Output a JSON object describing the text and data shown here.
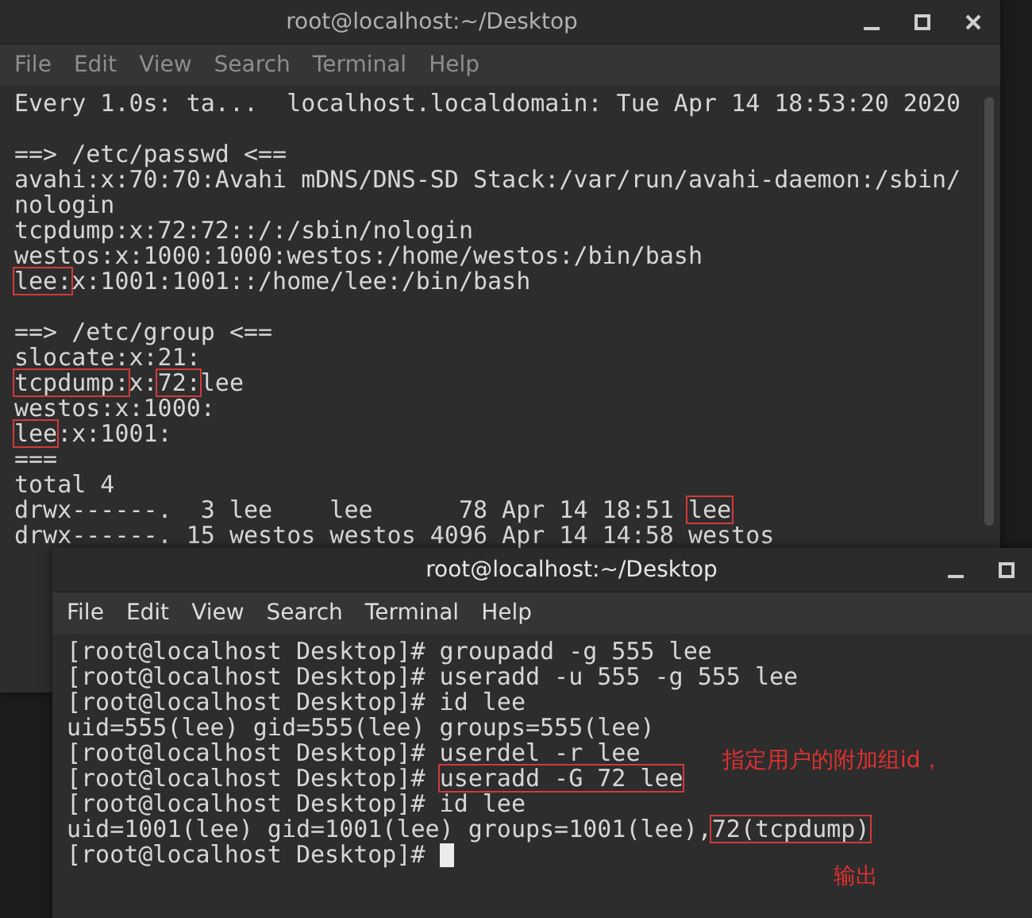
{
  "windows": [
    {
      "title": "root@localhost:~/Desktop",
      "active": false,
      "menu": [
        "File",
        "Edit",
        "View",
        "Search",
        "Terminal",
        "Help"
      ],
      "cursor": false,
      "lines": [
        {
          "segments": [
            {
              "text": "Every 1.0s: ta...  localhost.localdomain: Tue Apr 14 18:53:20 2020",
              "boxed": false
            }
          ]
        },
        {
          "blank_before": true,
          "segments": [
            {
              "text": "==> /etc/passwd <==",
              "boxed": false
            }
          ]
        },
        {
          "segments": [
            {
              "text": "avahi:x:70:70:Avahi mDNS/DNS-SD Stack:/var/run/avahi-daemon:/sbin/",
              "boxed": false
            }
          ]
        },
        {
          "segments": [
            {
              "text": "nologin",
              "boxed": false
            }
          ]
        },
        {
          "segments": [
            {
              "text": "tcpdump:x:72:72::/:/sbin/nologin",
              "boxed": false
            }
          ]
        },
        {
          "segments": [
            {
              "text": "westos:x:1000:1000:westos:/home/westos:/bin/bash",
              "boxed": false
            }
          ]
        },
        {
          "segments": [
            {
              "text": "lee:",
              "boxed": true
            },
            {
              "text": "x:1001:1001::/home/lee:/bin/bash",
              "boxed": false
            }
          ]
        },
        {
          "blank_before": true,
          "segments": [
            {
              "text": "==> /etc/group <==",
              "boxed": false
            }
          ]
        },
        {
          "segments": [
            {
              "text": "slocate:x:21:",
              "boxed": false
            }
          ]
        },
        {
          "segments": [
            {
              "text": "tcpdump:",
              "boxed": true
            },
            {
              "text": "x:",
              "boxed": false
            },
            {
              "text": "72:",
              "boxed": true
            },
            {
              "text": "lee",
              "boxed": false
            }
          ]
        },
        {
          "segments": [
            {
              "text": "westos:x:1000:",
              "boxed": false
            }
          ]
        },
        {
          "segments": [
            {
              "text": "lee",
              "boxed": true
            },
            {
              "text": ":x:1001:",
              "boxed": false
            }
          ]
        },
        {
          "segments": [
            {
              "text": "===",
              "boxed": false
            }
          ]
        },
        {
          "segments": [
            {
              "text": "total 4",
              "boxed": false
            }
          ]
        },
        {
          "segments": [
            {
              "text": "drwx------.  3 lee    lee      78 Apr 14 18:51 ",
              "boxed": false
            },
            {
              "text": "lee",
              "boxed": true
            }
          ]
        },
        {
          "segments": [
            {
              "text": "drwx------. 15 westos westos 4096 Apr 14 14:58 westos",
              "boxed": false
            }
          ]
        }
      ]
    },
    {
      "title": "root@localhost:~/Desktop",
      "active": true,
      "menu": [
        "File",
        "Edit",
        "View",
        "Search",
        "Terminal",
        "Help"
      ],
      "cursor": true,
      "lines": [
        {
          "segments": [
            {
              "text": "[root@localhost Desktop]# groupadd -g 555 lee",
              "boxed": false
            }
          ]
        },
        {
          "segments": [
            {
              "text": "[root@localhost Desktop]# useradd -u 555 -g 555 lee",
              "boxed": false
            }
          ]
        },
        {
          "segments": [
            {
              "text": "[root@localhost Desktop]# id lee",
              "boxed": false
            }
          ]
        },
        {
          "segments": [
            {
              "text": "uid=555(lee) gid=555(lee) groups=555(lee)",
              "boxed": false
            }
          ]
        },
        {
          "segments": [
            {
              "text": "[root@localhost Desktop]# userdel -r lee",
              "boxed": false
            }
          ]
        },
        {
          "segments": [
            {
              "text": "[root@localhost Desktop]# ",
              "boxed": false
            },
            {
              "text": "useradd -G 72 lee",
              "boxed": true
            }
          ]
        },
        {
          "segments": [
            {
              "text": "[root@localhost Desktop]# id lee",
              "boxed": false
            }
          ]
        },
        {
          "segments": [
            {
              "text": "uid=1001(lee) gid=1001(lee) groups=1001(lee),",
              "boxed": false
            },
            {
              "text": "72(tcpdump)",
              "boxed": true
            }
          ]
        },
        {
          "segments": [
            {
              "text": "[root@localhost Desktop]# ",
              "boxed": false
            }
          ]
        }
      ]
    }
  ],
  "annotations": [
    {
      "text": "指定用户的附加组id，"
    },
    {
      "text": "输出"
    }
  ]
}
